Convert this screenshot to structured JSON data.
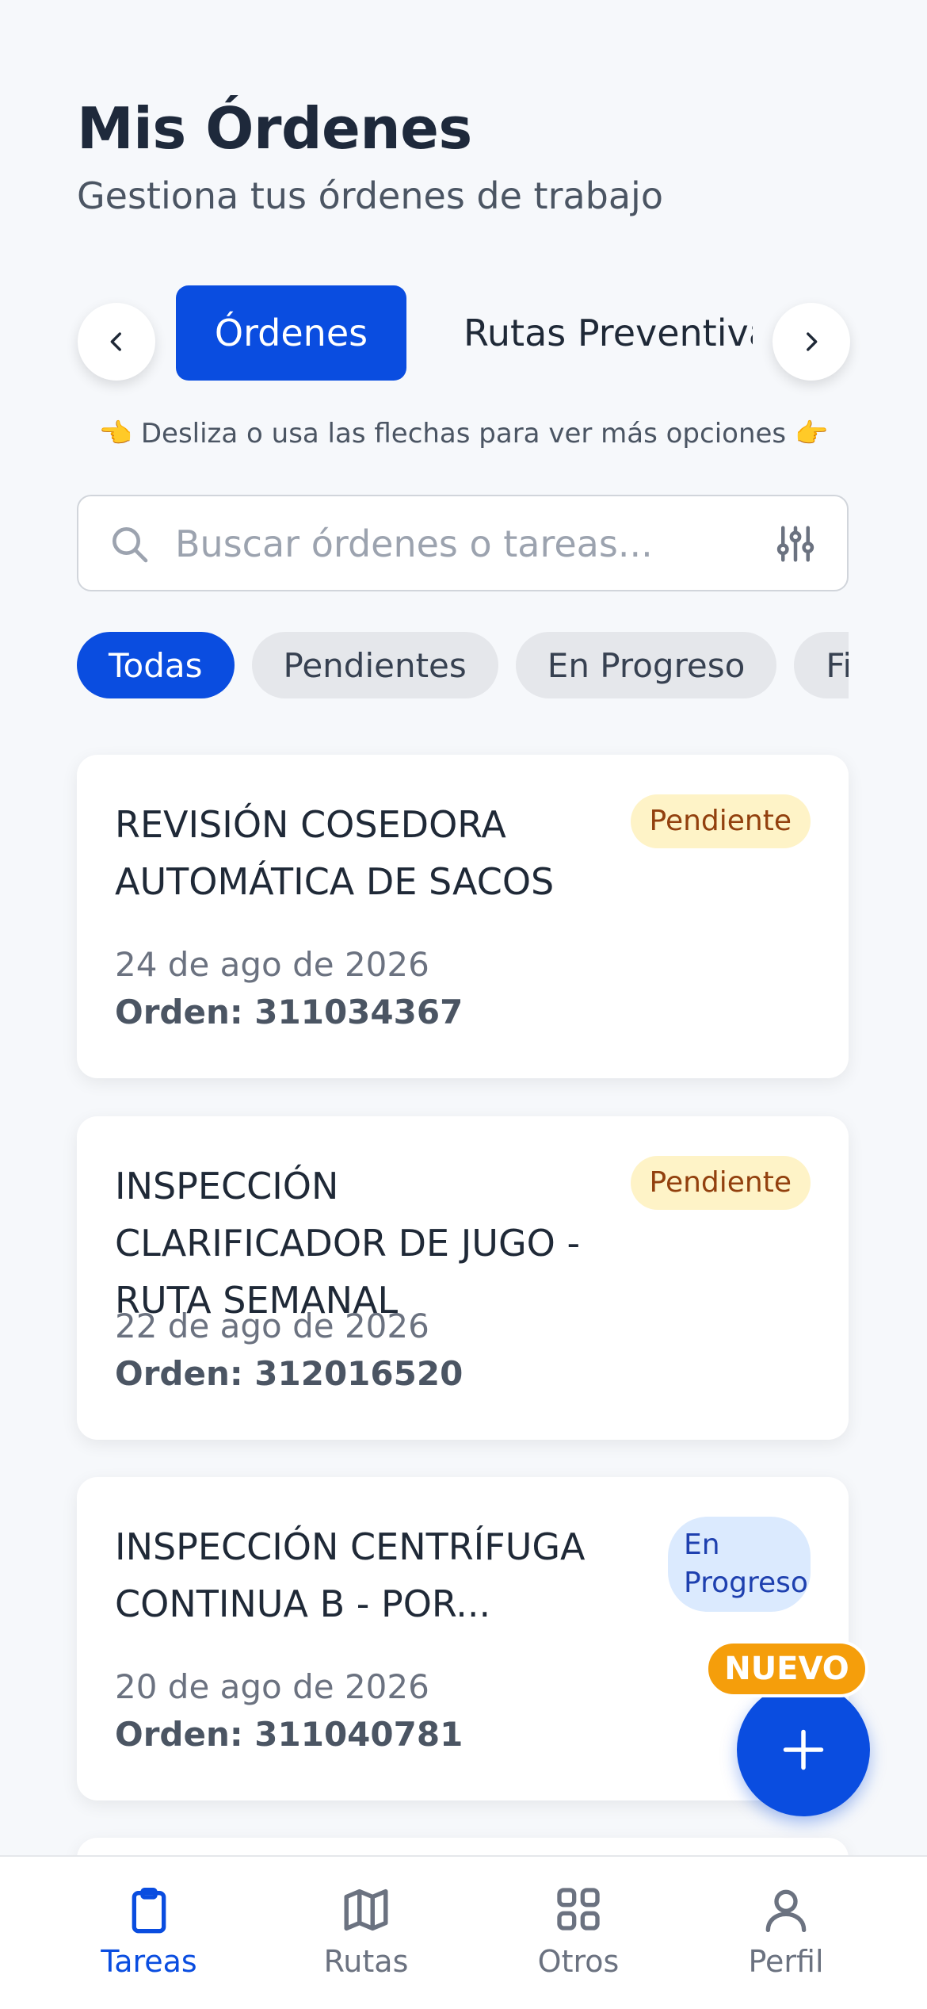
{
  "header": {
    "title": "Mis Órdenes",
    "subtitle": "Gestiona tus órdenes de trabajo"
  },
  "tabs": {
    "active": "Órdenes",
    "next": "Rutas Preventivas"
  },
  "hint": "👈 Desliza o usa las flechas para ver más opciones 👉",
  "search": {
    "placeholder": "Buscar órdenes o tareas..."
  },
  "filters": [
    "Todas",
    "Pendientes",
    "En Progreso",
    "Finalizadas"
  ],
  "orders": [
    {
      "title": "REVISIÓN COSEDORA AUTOMÁTICA DE SACOS",
      "status": "Pendiente",
      "date": "24 de ago de 2026",
      "order": "Orden: 311034367"
    },
    {
      "title": "INSPECCIÓN CLARIFICADOR DE JUGO - RUTA SEMANAL",
      "status": "Pendiente",
      "date": "22 de ago de 2026",
      "order": "Orden: 312016520"
    },
    {
      "title": "INSPECCIÓN CENTRÍFUGA CONTINUA B - POR...",
      "status": "En Progreso",
      "date": "20 de ago de 2026",
      "order": "Orden: 311040781"
    }
  ],
  "fab": {
    "badge": "NUEVO"
  },
  "nav": [
    {
      "label": "Tareas",
      "icon": "clipboard-icon"
    },
    {
      "label": "Rutas",
      "icon": "map-icon"
    },
    {
      "label": "Otros",
      "icon": "grid-icon"
    },
    {
      "label": "Perfil",
      "icon": "user-icon"
    }
  ],
  "colors": {
    "primary": "#0a4de0",
    "pending_bg": "#fef3c7",
    "pending_text": "#92400e",
    "progress_bg": "#dbeafe",
    "progress_text": "#1e40af",
    "new_badge": "#f59e0b"
  }
}
